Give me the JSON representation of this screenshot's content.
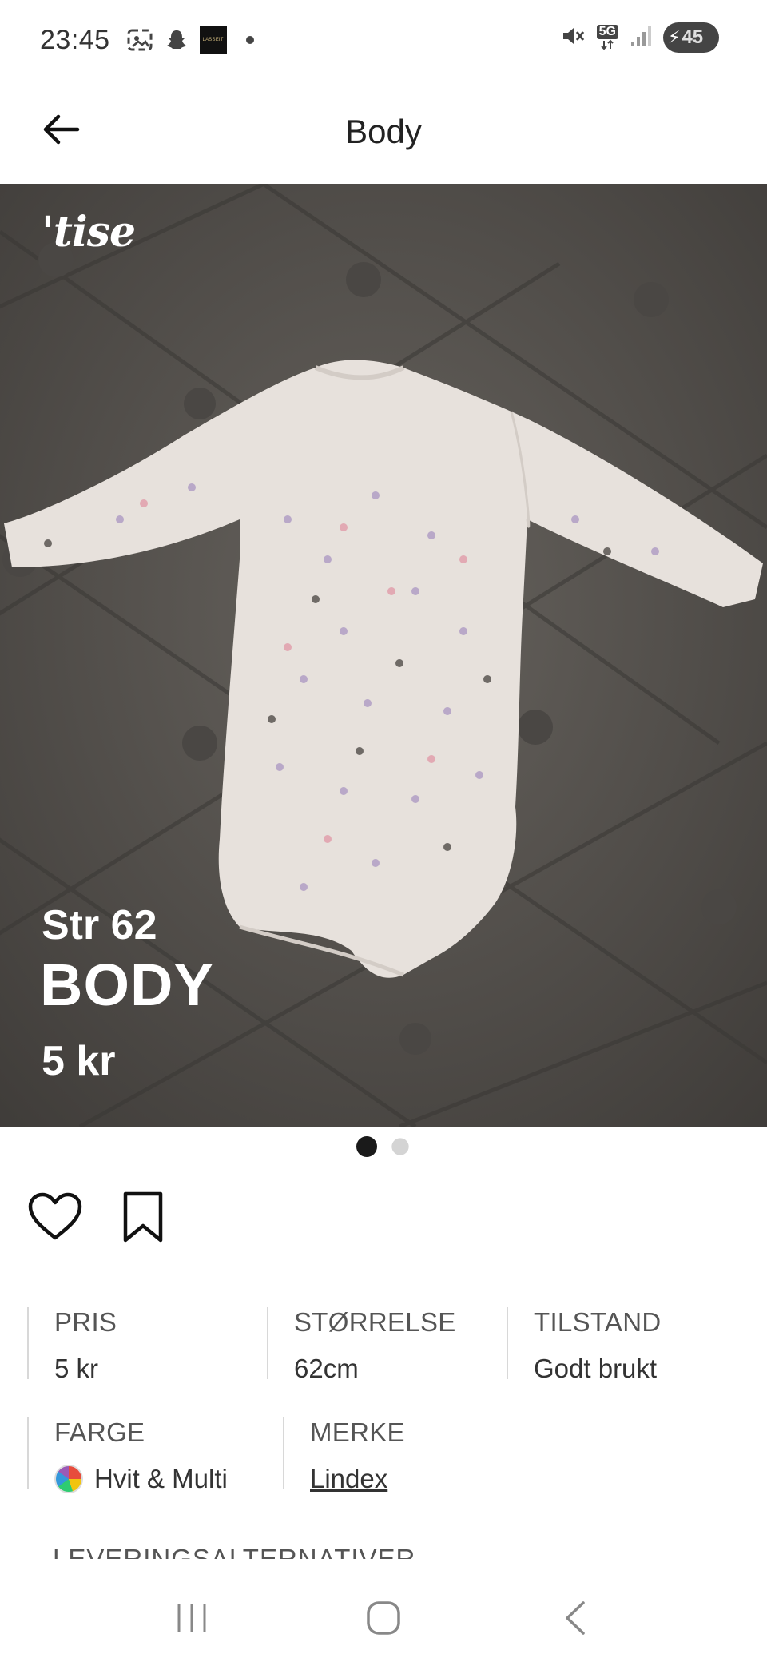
{
  "status_bar": {
    "time": "23:45",
    "left_icons": [
      "screenshot-icon",
      "snapchat-icon",
      "app-thumbnail-icon",
      "dot-icon"
    ],
    "app_thumbnail_text": "LASSEIT",
    "right_icons": [
      "mute-icon",
      "5g-icon",
      "signal-icon"
    ],
    "network": "5G",
    "battery_level": "45"
  },
  "header": {
    "title": "Body",
    "back_icon": "arrow-left-icon"
  },
  "hero": {
    "logo": "'tise",
    "size_text": "Str 62",
    "title": "BODY",
    "price": "5 kr",
    "image_description_icon": "baby-bodysuit-photo"
  },
  "carousel": {
    "total": 2,
    "active_index": 0
  },
  "actions": {
    "like_icon": "heart-icon",
    "save_icon": "bookmark-icon"
  },
  "attributes": {
    "row1": [
      {
        "label": "PRIS",
        "value": "5 kr"
      },
      {
        "label": "STØRRELSE",
        "value": "62cm"
      },
      {
        "label": "TILSTAND",
        "value": "Godt brukt"
      }
    ],
    "row2": [
      {
        "label": "FARGE",
        "value": "Hvit & Multi"
      },
      {
        "label": "MERKE",
        "value": "Lindex"
      }
    ]
  },
  "delivery_label": "LEVERINGSALTERNATIVER",
  "navbar": {
    "recents_icon": "recents-icon",
    "home_icon": "home-icon",
    "back_icon": "back-chevron-icon"
  },
  "colors": {
    "background": "#ffffff",
    "hero_bg": "#56534f",
    "text_primary": "#222222",
    "text_secondary": "#555555",
    "dot_active": "#1a1a1a",
    "dot_inactive": "#d4d4d4"
  }
}
